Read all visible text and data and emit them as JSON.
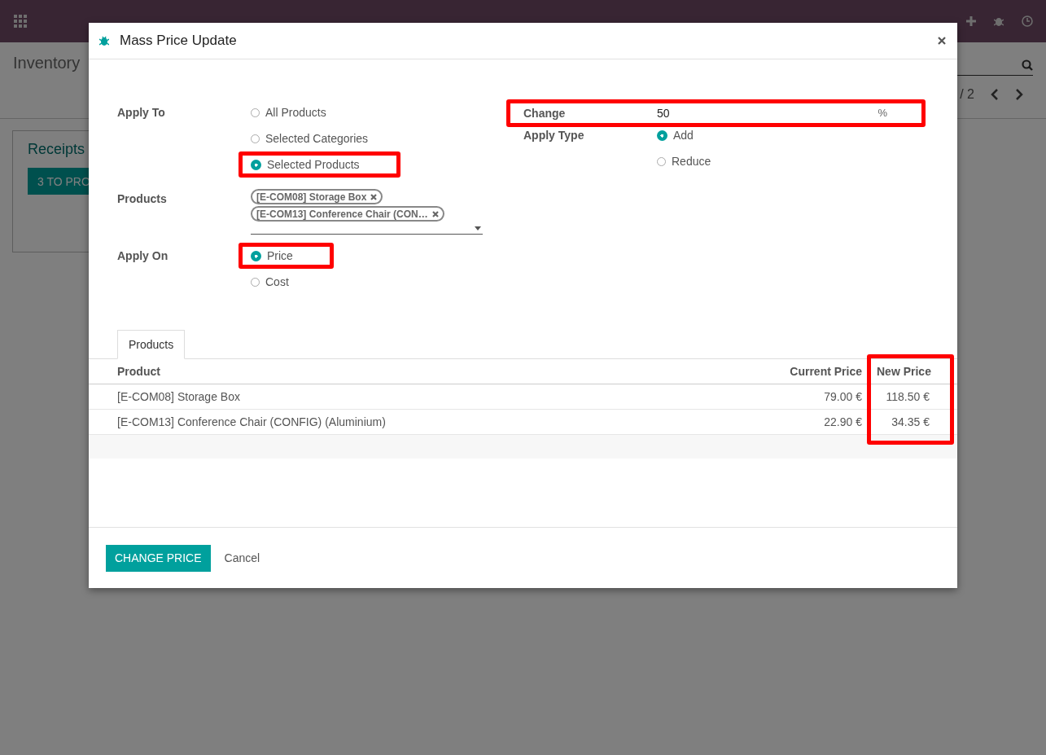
{
  "background": {
    "title": "Inventory",
    "pager": "/ 2",
    "card": {
      "title": "Receipts",
      "button": "3 TO PRO"
    }
  },
  "dialog": {
    "title": "Mass Price Update",
    "apply_to": {
      "label": "Apply To",
      "options": [
        {
          "label": "All Products",
          "selected": false,
          "highlighted": false
        },
        {
          "label": "Selected Categories",
          "selected": false,
          "highlighted": false
        },
        {
          "label": "Selected Products",
          "selected": true,
          "highlighted": true
        }
      ]
    },
    "products": {
      "label": "Products",
      "tags": [
        "[E-COM08] Storage Box",
        "[E-COM13] Conference Chair (CON…"
      ]
    },
    "apply_on": {
      "label": "Apply On",
      "options": [
        {
          "label": "Price",
          "selected": true,
          "highlighted": true
        },
        {
          "label": "Cost",
          "selected": false,
          "highlighted": false
        }
      ]
    },
    "change": {
      "label": "Change",
      "value": "50",
      "unit": "%",
      "highlighted": true
    },
    "apply_type": {
      "label": "Apply Type",
      "options": [
        {
          "label": "Add",
          "selected": true,
          "highlighted": false
        },
        {
          "label": "Reduce",
          "selected": false,
          "highlighted": false
        }
      ]
    },
    "tabs": [
      {
        "label": "Products",
        "selected": true
      }
    ],
    "table": {
      "columns": [
        {
          "label": "Product",
          "highlighted": false
        },
        {
          "label": "Current Price",
          "highlighted": false
        },
        {
          "label": "New Price",
          "highlighted": true
        }
      ],
      "rows": [
        [
          "[E-COM08] Storage Box",
          "79.00 €",
          "118.50 €"
        ],
        [
          "[E-COM13] Conference Chair (CONFIG) (Aluminium)",
          "22.90 €",
          "34.35 €"
        ]
      ]
    },
    "buttons": [
      {
        "label": "CHANGE PRICE",
        "kind": "primary"
      },
      {
        "label": "Cancel",
        "kind": "secondary"
      }
    ]
  }
}
